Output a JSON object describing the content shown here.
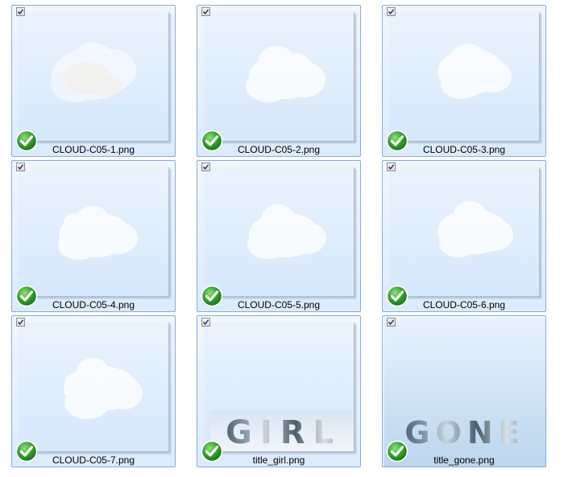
{
  "files": [
    {
      "name": "CLOUD-C05-1.png",
      "checked": true,
      "kind": "cloud",
      "thumbnail": "cloud-thumbnail"
    },
    {
      "name": "CLOUD-C05-2.png",
      "checked": true,
      "kind": "cloud",
      "thumbnail": "cloud-thumbnail"
    },
    {
      "name": "CLOUD-C05-3.png",
      "checked": true,
      "kind": "cloud",
      "thumbnail": "cloud-thumbnail"
    },
    {
      "name": "CLOUD-C05-4.png",
      "checked": true,
      "kind": "cloud",
      "thumbnail": "cloud-thumbnail"
    },
    {
      "name": "CLOUD-C05-5.png",
      "checked": true,
      "kind": "cloud",
      "thumbnail": "cloud-thumbnail"
    },
    {
      "name": "CLOUD-C05-6.png",
      "checked": true,
      "kind": "cloud",
      "thumbnail": "cloud-thumbnail"
    },
    {
      "name": "CLOUD-C05-7.png",
      "checked": true,
      "kind": "cloud",
      "thumbnail": "cloud-thumbnail"
    },
    {
      "name": "title_girl.png",
      "checked": true,
      "kind": "title",
      "word": "GIRL",
      "thumbnail": "title-word-thumbnail"
    },
    {
      "name": "title_gone.png",
      "checked": true,
      "kind": "title",
      "word": "GONE",
      "thumbnail": "title-word-thumbnail"
    }
  ],
  "icons": {
    "checkbox": "checkbox-checked-icon",
    "status": "green-checkmark-icon"
  },
  "colors": {
    "tile_border": "#84acdd",
    "tile_bg": "#e4effd",
    "badge_green": "#2fa02a"
  }
}
